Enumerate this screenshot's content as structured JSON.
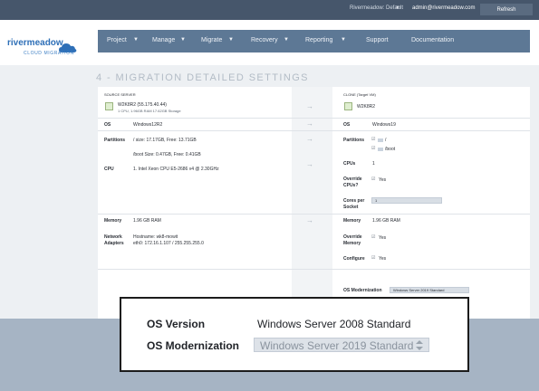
{
  "topbar": {
    "tenant": "Rivermeadow: Default",
    "user_email": "admin@rivermeadow.com",
    "refresh_label": "Refresh"
  },
  "logo": {
    "word": "rivermeadow",
    "tagline": "CLOUD MIGRATION"
  },
  "nav": [
    {
      "label": "Project",
      "has_caret": true
    },
    {
      "label": "Manage",
      "has_caret": true
    },
    {
      "label": "Migrate",
      "has_caret": true
    },
    {
      "label": "Recovery",
      "has_caret": true
    },
    {
      "label": "Reporting",
      "has_caret": true
    },
    {
      "label": "Support",
      "has_caret": false
    },
    {
      "label": "Documentation",
      "has_caret": false
    }
  ],
  "page_title": "4 - MIGRATION DETAILED SETTINGS",
  "source": {
    "header": "SOURCE SERVER",
    "name": "W2K8R2 (55.175.40.44)",
    "specs": "1 CPU, 1.96GB RAM 17.62GB Storage",
    "os_label": "OS",
    "os_value": "Windows12R2",
    "partitions_label": "Partitions",
    "partition_1": "/ size: 17.17GB, Free: 13.71GB",
    "partition_2": "/boot Size: 0.47GB, Free: 0.41GB",
    "cpu_label": "CPU",
    "cpu_value": "1. Intel Xeon CPU E5-2686 v4 @ 2.30GHz",
    "memory_label": "Memory",
    "memory_value": "1.96 GB RAM",
    "network_label": "Network",
    "adapters_label": "Adapters",
    "hostname": "Hostname: wk8-mowit",
    "eth": "eth0: 172.16.1.107 / 255.255.255.0"
  },
  "clone": {
    "header": "CLONE (Target VM)",
    "name": "W2K8R2",
    "os_label": "OS",
    "os_value": "Windows19",
    "partitions_label": "Partitions",
    "partition_1": "/",
    "partition_2": "/boot",
    "cpus_label": "CPUs",
    "cpus_value": "1",
    "override_cpus_label_1": "Override",
    "override_cpus_label_2": "CPUs?",
    "override_cpus_value": "Yes",
    "cores_label_1": "Cores per",
    "cores_label_2": "Socket",
    "cores_value": "1",
    "memory_label": "Memory",
    "memory_value": "1.96 GB RAM",
    "override_mem_label_1": "Override",
    "override_mem_label_2": "Memory",
    "override_mem_value": "Yes",
    "configure_label": "Configure",
    "configure_value": "Yes",
    "os_mod_label": "OS Modernization",
    "os_mod_value": "Windows Server 2019 Standard"
  },
  "callout": {
    "os_version_label": "OS Version",
    "os_version_value": "Windows Server 2008 Standard",
    "os_mod_label": "OS Modernization",
    "os_mod_value": "Windows Server 2019 Standard"
  },
  "colors": {
    "topbar": "#46566b",
    "nav": "#5d7895",
    "brand": "#2e6fb7",
    "bottom_band": "#a6b4c4"
  }
}
